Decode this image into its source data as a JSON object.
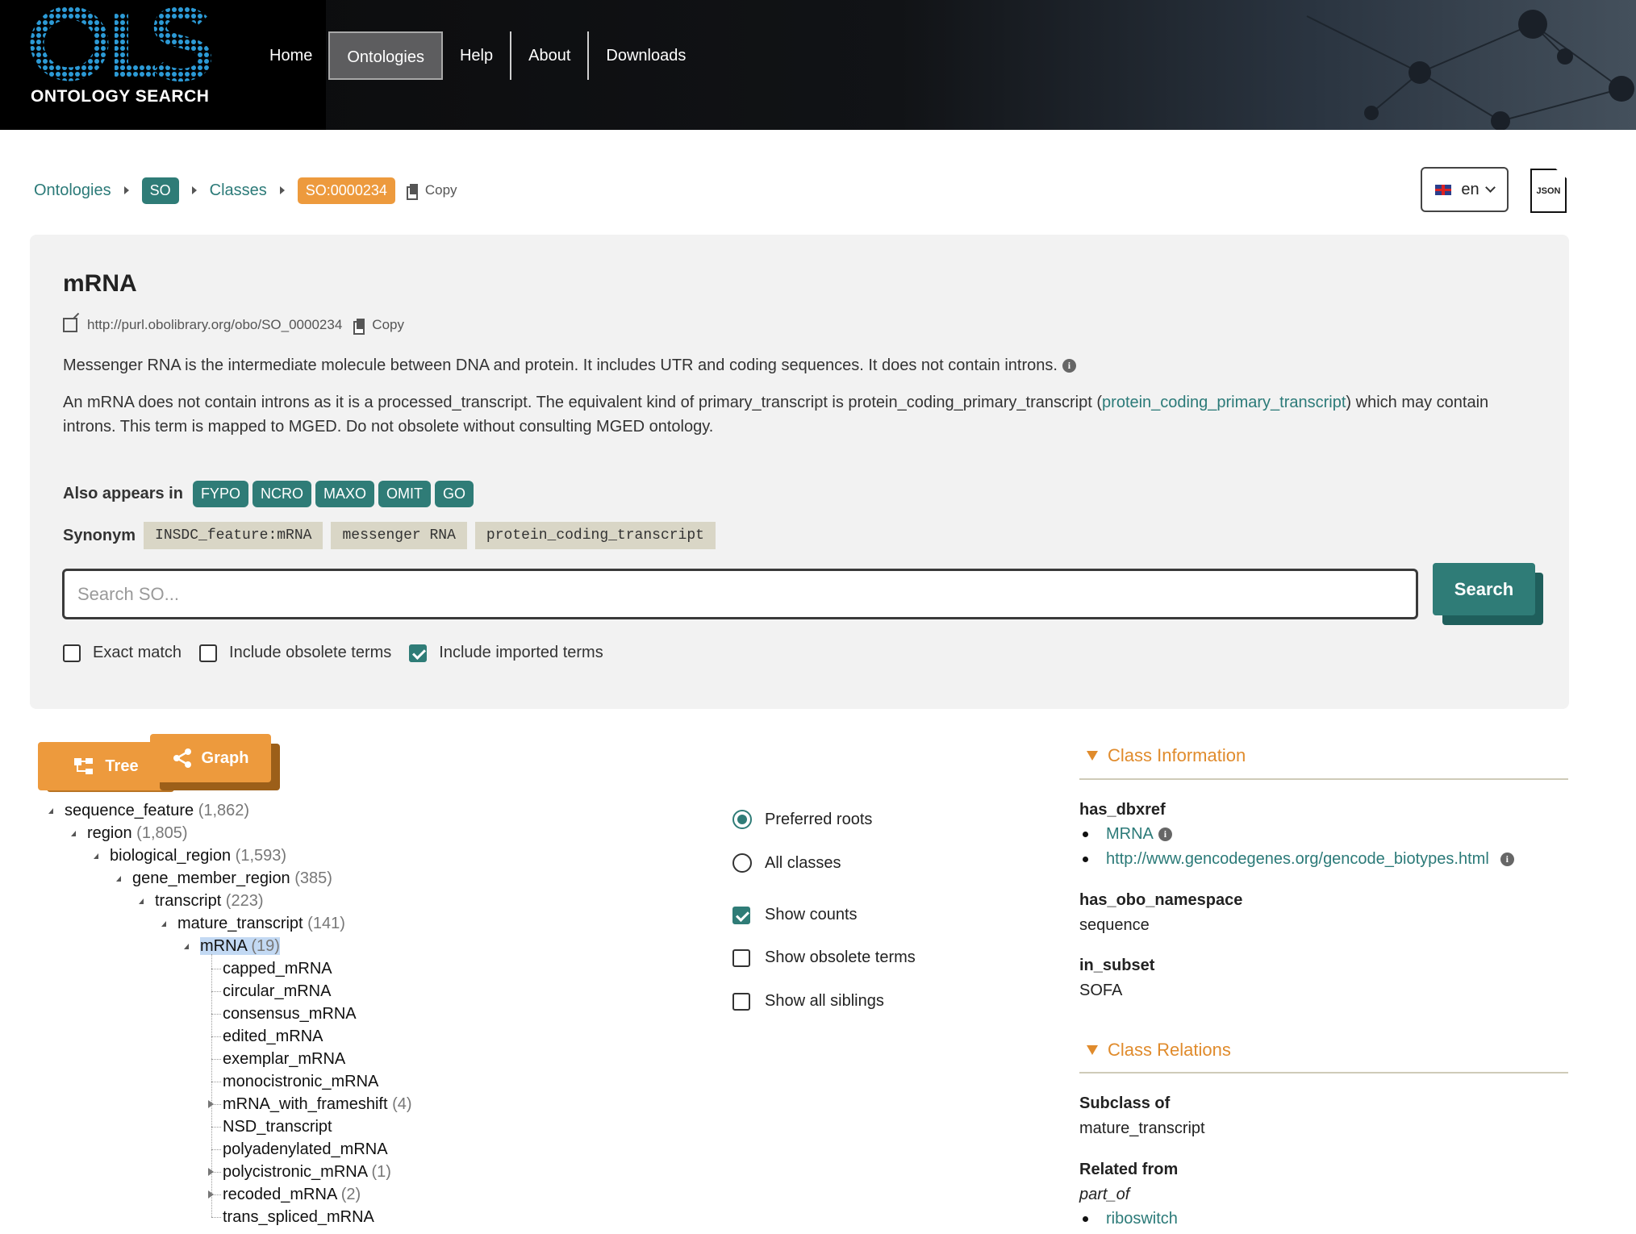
{
  "header": {
    "logo_text": "ONTOLOGY SEARCH",
    "logo_letters": "OLS",
    "nav": [
      "Home",
      "Ontologies",
      "Help",
      "About",
      "Downloads"
    ],
    "active_nav": "Ontologies"
  },
  "breadcrumb": {
    "ontologies": "Ontologies",
    "ontology_id": "SO",
    "classes": "Classes",
    "term_id": "SO:0000234",
    "copy_label": "Copy"
  },
  "language": "en",
  "json_label": "JSON",
  "term": {
    "title": "mRNA",
    "iri": "http://purl.obolibrary.org/obo/SO_0000234",
    "copy_label": "Copy",
    "definition": "Messenger RNA is the intermediate molecule between DNA and protein. It includes UTR and coding sequences. It does not contain introns.",
    "comment_part1": "An mRNA does not contain introns as it is a processed_transcript. The equivalent kind of primary_transcript is protein_coding_primary_transcript (",
    "comment_link": "protein_coding_primary_transcript",
    "comment_part2": ") which may contain",
    "comment_line2": "introns. This term is mapped to MGED. Do not obsolete without consulting MGED ontology."
  },
  "also_appears": {
    "label": "Also appears in",
    "tags": [
      "FYPO",
      "NCRO",
      "MAXO",
      "OMIT",
      "GO"
    ]
  },
  "synonym": {
    "label": "Synonym",
    "values": [
      "INSDC_feature:mRNA",
      "messenger RNA",
      "protein_coding_transcript"
    ]
  },
  "search": {
    "placeholder": "Search SO...",
    "button": "Search",
    "options": [
      {
        "label": "Exact match",
        "checked": false
      },
      {
        "label": "Include obsolete terms",
        "checked": false
      },
      {
        "label": "Include imported terms",
        "checked": true
      }
    ]
  },
  "view_buttons": {
    "tree": "Tree",
    "graph": "Graph"
  },
  "tree": {
    "ancestors": [
      {
        "label": "sequence_feature",
        "count": "(1,862)"
      },
      {
        "label": "region",
        "count": "(1,805)"
      },
      {
        "label": "biological_region",
        "count": "(1,593)"
      },
      {
        "label": "gene_member_region",
        "count": "(385)"
      },
      {
        "label": "transcript",
        "count": "(223)"
      },
      {
        "label": "mature_transcript",
        "count": "(141)"
      },
      {
        "label": "mRNA",
        "count": "(19)"
      }
    ],
    "children": [
      {
        "label": "capped_mRNA",
        "count": ""
      },
      {
        "label": "circular_mRNA",
        "count": ""
      },
      {
        "label": "consensus_mRNA",
        "count": ""
      },
      {
        "label": "edited_mRNA",
        "count": ""
      },
      {
        "label": "exemplar_mRNA",
        "count": ""
      },
      {
        "label": "monocistronic_mRNA",
        "count": ""
      },
      {
        "label": "mRNA_with_frameshift",
        "count": "(4)",
        "expandable": true
      },
      {
        "label": "NSD_transcript",
        "count": ""
      },
      {
        "label": "polyadenylated_mRNA",
        "count": ""
      },
      {
        "label": "polycistronic_mRNA",
        "count": "(1)",
        "expandable": true
      },
      {
        "label": "recoded_mRNA",
        "count": "(2)",
        "expandable": true
      },
      {
        "label": "trans_spliced_mRNA",
        "count": ""
      }
    ]
  },
  "tree_options": {
    "preferred_roots": "Preferred roots",
    "all_classes": "All classes",
    "show_counts": "Show counts",
    "show_obsolete": "Show obsolete terms",
    "show_siblings": "Show all siblings",
    "root_selection": "Preferred roots",
    "show_counts_checked": true,
    "show_obsolete_checked": false,
    "show_siblings_checked": false
  },
  "class_information": {
    "heading": "Class Information",
    "has_dbxref_label": "has_dbxref",
    "dbxrefs": [
      "MRNA",
      "http://www.gencodegenes.org/gencode_biotypes.html"
    ],
    "namespace_label": "has_obo_namespace",
    "namespace_value": "sequence",
    "subset_label": "in_subset",
    "subset_value": "SOFA"
  },
  "class_relations": {
    "heading": "Class Relations",
    "subclass_label": "Subclass of",
    "subclass_value": "mature_transcript",
    "related_label": "Related from",
    "relation": "part_of",
    "related_values": [
      "riboswitch"
    ]
  },
  "colors": {
    "teal": "#2f7c77",
    "orange": "#ed9a3d",
    "section_orange": "#e08b2c",
    "panel_bg": "#f2f2f2",
    "synonym_bg": "#d9d6c6"
  }
}
